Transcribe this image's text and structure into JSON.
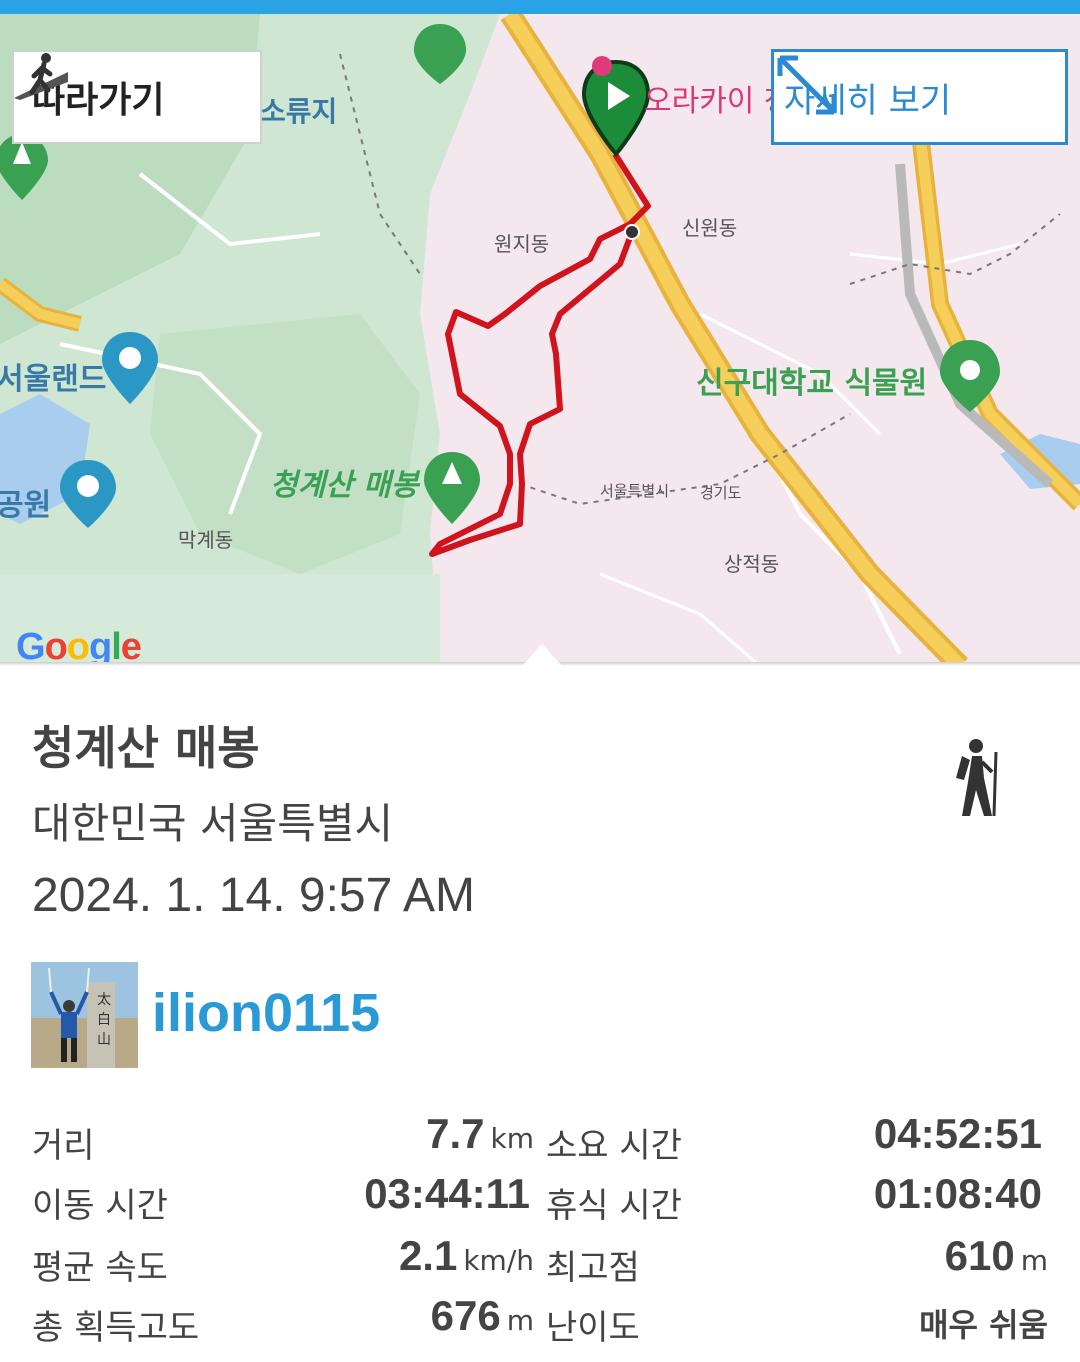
{
  "map": {
    "follow_label": "따라가기",
    "detail_label": "자세히 보기",
    "google_logo": "Google",
    "labels": {
      "suryuji": "소류지",
      "seouland": "서울랜드",
      "park": "공원",
      "cheonggye_maebong": "청계산 매봉",
      "makgye_dong": "막계동",
      "wonji_dong": "원지동",
      "sinwon_dong": "신원동",
      "shingu_garden": "신구대학교 식물원",
      "seoul_border": "서울특별시",
      "gyeonggi": "경기도",
      "sangjeok_dong": "상적동",
      "orakai": "오라카이 청"
    }
  },
  "activity": {
    "title": "청계산 매봉",
    "location": "대한민국 서울특별시",
    "datetime": "2024. 1. 14. 9:57 AM",
    "activity_icon": "hiking-icon"
  },
  "user": {
    "username": "ilion0115",
    "avatar_icon": "user-avatar"
  },
  "stats": {
    "distance": {
      "label": "거리",
      "value": "7.7",
      "unit": "km"
    },
    "duration": {
      "label": "소요 시간",
      "value": "04:52:51"
    },
    "moving_time": {
      "label": "이동 시간",
      "value": "03:44:11"
    },
    "rest_time": {
      "label": "휴식 시간",
      "value": "01:08:40"
    },
    "avg_speed": {
      "label": "평균 속도",
      "value": "2.1",
      "unit": "km/h"
    },
    "max_elevation": {
      "label": "최고점",
      "value": "610",
      "unit": "m"
    },
    "total_ascent": {
      "label": "총 획득고도",
      "value": "676",
      "unit": "m"
    },
    "difficulty": {
      "label": "난이도",
      "value": "매우 쉬움"
    }
  },
  "colors": {
    "accent_blue": "#2a9ad6",
    "route_red": "#d0141e",
    "park_green": "#3aa052"
  }
}
